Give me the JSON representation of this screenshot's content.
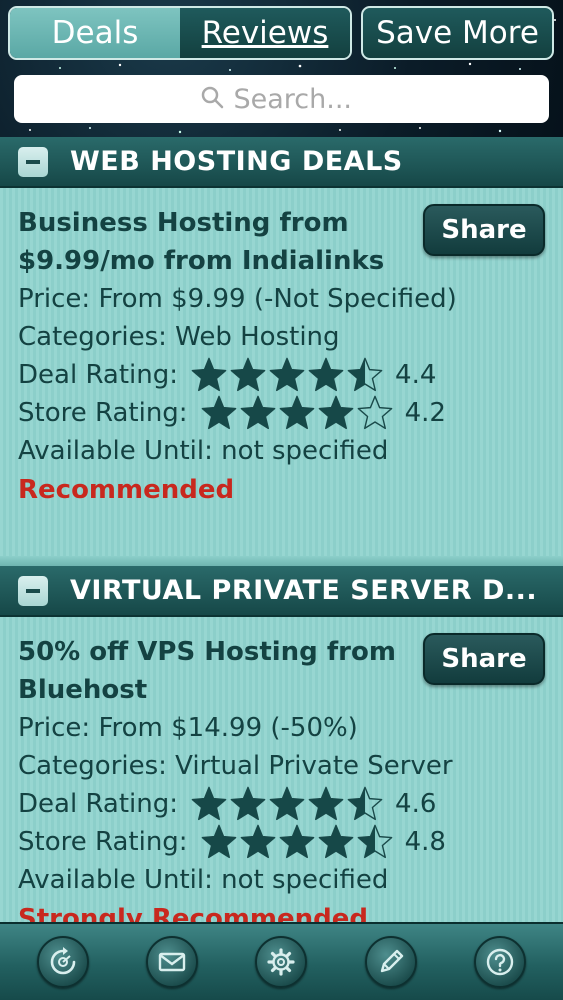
{
  "header": {
    "tabs": [
      {
        "label": "Deals",
        "active": true
      },
      {
        "label": "Reviews",
        "active": false
      }
    ],
    "save_more_label": "Save More",
    "search": {
      "placeholder": "Search...",
      "icon": "search-icon"
    }
  },
  "sections": [
    {
      "title": "WEB HOSTING DEALS",
      "deal": {
        "title": "Business Hosting from $9.99/mo from Indialinks",
        "share_label": "Share",
        "price": "Price: From $9.99 (-Not Specified)",
        "categories": "Categories: Web Hosting",
        "deal_rating_label": "Deal Rating:",
        "deal_rating_value": "4.4",
        "deal_rating": 4.4,
        "store_rating_label": "Store Rating:",
        "store_rating_value": "4.2",
        "store_rating": 4.2,
        "available": "Available Until: not specified",
        "badge": "Recommended"
      }
    },
    {
      "title": "VIRTUAL PRIVATE SERVER D...",
      "deal": {
        "title": "50% off VPS Hosting from Bluehost",
        "share_label": "Share",
        "price": "Price: From $14.99 (-50%)",
        "categories": "Categories: Virtual Private Server",
        "deal_rating_label": "Deal Rating:",
        "deal_rating_value": "4.6",
        "deal_rating": 4.6,
        "store_rating_label": "Store Rating:",
        "store_rating_value": "4.8",
        "store_rating": 4.8,
        "available": "Available Until: not specified",
        "badge": "Strongly Recommended"
      }
    }
  ],
  "toolbar": {
    "icons": [
      "refresh-icon",
      "mail-icon",
      "gear-icon",
      "pencil-icon",
      "help-icon"
    ]
  },
  "colors": {
    "accent_teal": "#1f5a5c",
    "card_bg": "#97d6d1",
    "text_dark": "#144242",
    "badge_red": "#c8281e"
  }
}
